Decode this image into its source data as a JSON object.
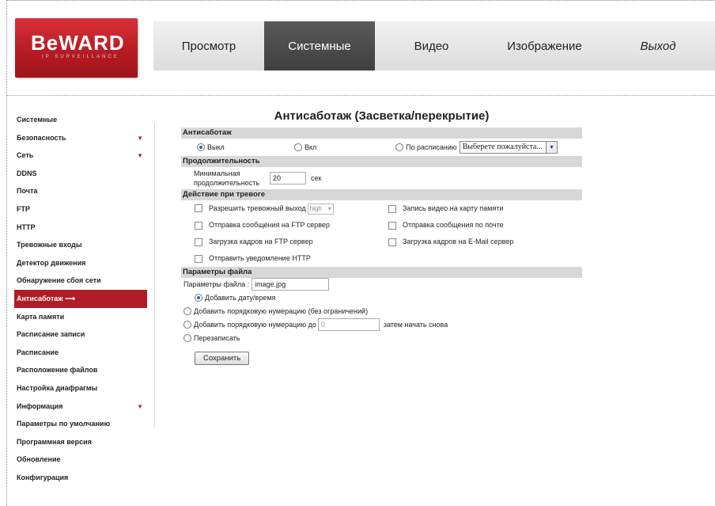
{
  "logo": {
    "brand": "BeWARD",
    "sub": "IP SURVEILLANCE"
  },
  "nav": [
    "Просмотр",
    "Системные",
    "Видео",
    "Изображение",
    "Выход"
  ],
  "sidebar": [
    "Системные",
    "Безопасность",
    "Сеть",
    "DDNS",
    "Почта",
    "FTP",
    "HTTP",
    "Тревожные входы",
    "Детектор движения",
    "Обнаружение сбоя сети",
    "Антисаботаж",
    "Карта памяти",
    "Расписание записи",
    "Расписание",
    "Расположение файлов",
    "Настройка диафрагмы",
    "Информация",
    "Параметры по умолчанию",
    "Программная версия",
    "Обновление",
    "Конфигурация"
  ],
  "page": {
    "title": "Антисаботаж (Засветка/перекрытие)",
    "sec1": "Антисаботаж",
    "off": "Выкл",
    "on": "Вкл",
    "schedule": "По расписанию",
    "schedule_select": "Выберете пожалуйста...",
    "sec2": "Продолжительность",
    "min_dur_1": "Минимальная",
    "min_dur_2": "продолжительность",
    "dur_value": "20",
    "sec_unit": "сек",
    "sec3": "Действие при тревоге",
    "a1": "Разрешить тревожный выход",
    "a1_sel": "high",
    "a2": "Запись видео на карту памяти",
    "a3": "Отправка сообщения на FTP сервер",
    "a4": "Отправка сообщения по почте",
    "a5": "Загрузка кадров на FTP сервер",
    "a6": "Загрузка кадров на E-Mail сервер",
    "a7": "Отправить уведомление HTTP",
    "sec4": "Параметры файла",
    "file_label": "Параметры файла :",
    "file_value": "image.jpg",
    "opt1": "Добавить дату/время",
    "opt2": "Добавить порядковую нумерацию (без ограничений)",
    "opt3": "Добавить порядковую нумерацию до",
    "opt3_value": "0",
    "opt3_tail": "затем начать снова",
    "opt4": "Перезаписать",
    "save": "Сохранить"
  }
}
